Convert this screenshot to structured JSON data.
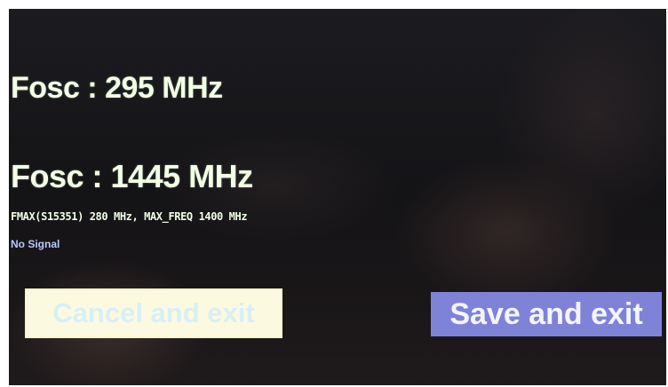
{
  "readout": {
    "fosc_1": "Fosc : 295 MHz",
    "fosc_2": "Fosc : 1445 MHz",
    "fmax_line": "FMAX(S15351) 280 MHz, MAX_FREQ 1400 MHz",
    "signal_status": "No Signal"
  },
  "buttons": {
    "cancel_label": "Cancel and exit",
    "save_label": "Save and exit"
  },
  "colors": {
    "text": "#f2ffe6",
    "status": "#b9c8ff",
    "cancel_bg": "#fbfae0",
    "save_bg": "#7f83d8"
  }
}
